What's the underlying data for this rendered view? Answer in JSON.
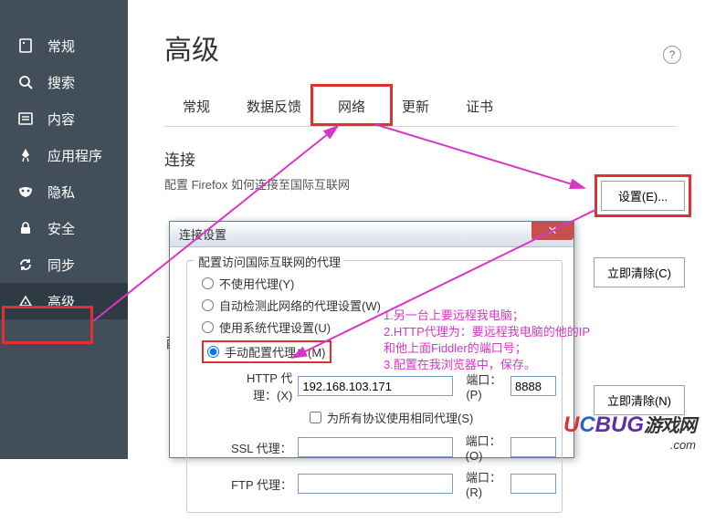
{
  "sidebar": {
    "items": [
      {
        "label": "常规"
      },
      {
        "label": "搜索"
      },
      {
        "label": "内容"
      },
      {
        "label": "应用程序"
      },
      {
        "label": "隐私"
      },
      {
        "label": "安全"
      },
      {
        "label": "同步"
      },
      {
        "label": "高级"
      }
    ]
  },
  "page": {
    "title": "高级",
    "help": "?"
  },
  "tabs": [
    {
      "label": "常规"
    },
    {
      "label": "数据反馈"
    },
    {
      "label": "网络"
    },
    {
      "label": "更新"
    },
    {
      "label": "证书"
    }
  ],
  "connection": {
    "heading": "连接",
    "desc": "配置 Firefox 如何连接至国际互联网",
    "settings_btn": "设置(E)..."
  },
  "buttons": {
    "clear1": "立即清除(C)",
    "clear2": "立即清除(N)",
    "partial": "配"
  },
  "dialog": {
    "title": "连接设置",
    "group_title": "配置访问国际互联网的代理",
    "r_none": "不使用代理(Y)",
    "r_auto": "自动检测此网络的代理设置(W)",
    "r_sys": "使用系统代理设置(U)",
    "r_manual": "手动配置代理：(M)",
    "http_label": "HTTP 代理：(X)",
    "http_value": "192.168.103.171",
    "port_label": "端口：(P)",
    "port_value": "8888",
    "same_all": "为所有协议使用相同代理(S)",
    "ssl_label": "SSL 代理：",
    "ssl_port_label": "端口：(O)",
    "ftp_label": "FTP 代理：",
    "ftp_port_label": "端口：(R)"
  },
  "annotations": {
    "l1": "1.另一台上要远程我电脑；",
    "l2": "2.HTTP代理为：要远程我电脑的他的IP",
    "l3": "和他上面Fiddler的端口号；",
    "l4": "3.配置在我浏览器中，保存。"
  },
  "watermark": {
    "brand_u": "U",
    "brand_c": "C",
    "brand_b": "BUG",
    "suffix": "游戏网",
    "dom": ".com"
  }
}
